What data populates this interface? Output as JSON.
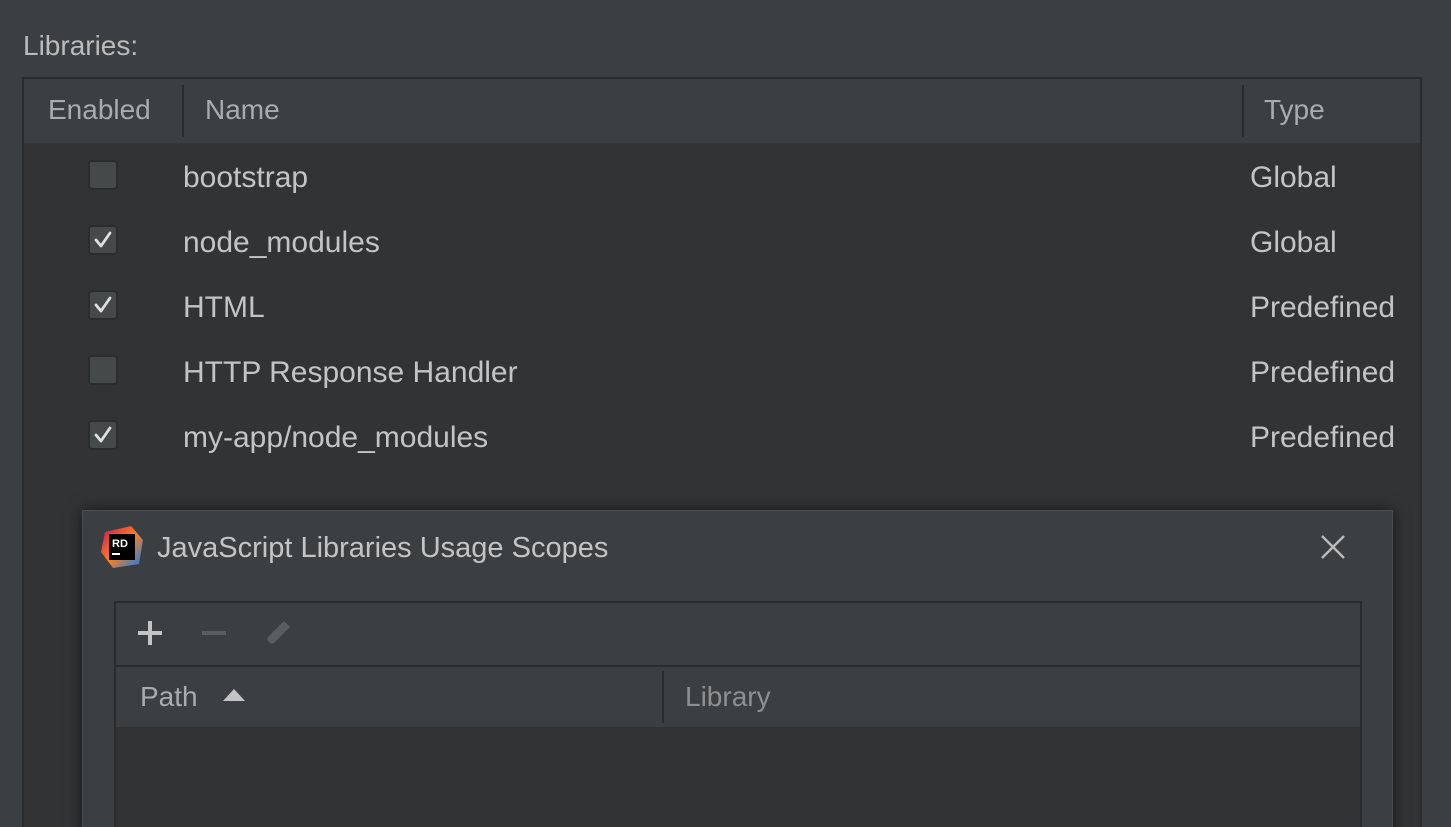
{
  "libraries": {
    "label": "Libraries:",
    "columns": {
      "enabled": "Enabled",
      "name": "Name",
      "type": "Type"
    },
    "rows": [
      {
        "enabled": false,
        "name": "bootstrap",
        "type": "Global"
      },
      {
        "enabled": true,
        "name": "node_modules",
        "type": "Global"
      },
      {
        "enabled": true,
        "name": "HTML",
        "type": "Predefined"
      },
      {
        "enabled": false,
        "name": "HTTP Response Handler",
        "type": "Predefined"
      },
      {
        "enabled": true,
        "name": "my-app/node_modules",
        "type": "Predefined"
      }
    ]
  },
  "dialog": {
    "title": "JavaScript Libraries Usage Scopes",
    "logo_text": "RD",
    "icons": {
      "logo": "rider-logo-icon",
      "close": "close-icon"
    },
    "toolbar": {
      "add": {
        "icon": "plus-icon",
        "enabled": true
      },
      "remove": {
        "icon": "minus-icon",
        "enabled": false
      },
      "edit": {
        "icon": "pencil-icon",
        "enabled": false
      }
    },
    "columns": {
      "path": "Path",
      "library": "Library"
    },
    "sort": {
      "column": "Path",
      "direction": "ascending"
    }
  },
  "colors": {
    "background": "#3c3f41",
    "table_background": "#313335",
    "text": "#c4c4c4",
    "border": "#2b2b2b"
  }
}
